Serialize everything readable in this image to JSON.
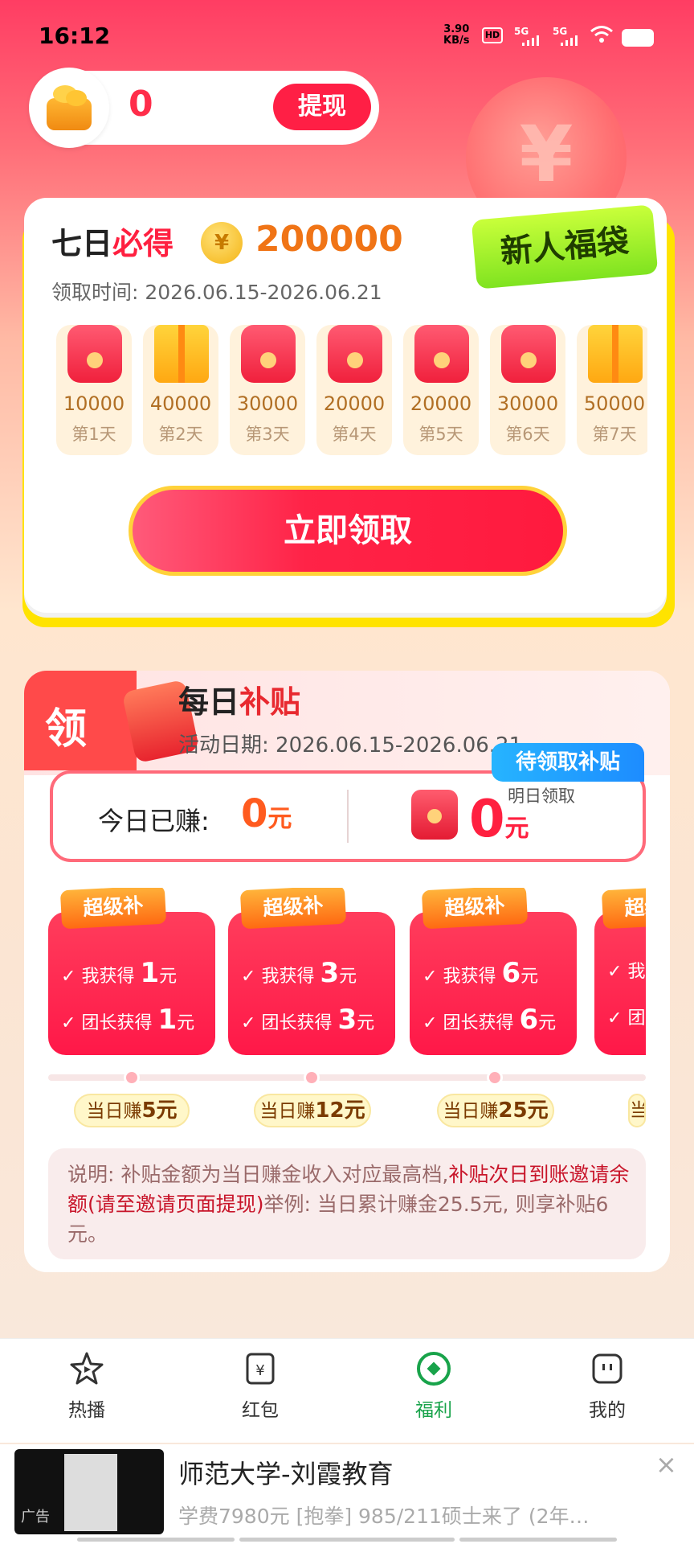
{
  "status": {
    "time": "16:12",
    "speed_top": "3.90",
    "speed_bottom": "KB/s",
    "hd": "HD",
    "net1": "5G",
    "net2": "5G"
  },
  "colors": {
    "accent": "#ff1f45",
    "orange": "#f07416",
    "green": "#18a34a",
    "lime": "#9cf02a"
  },
  "balance": {
    "value": "0",
    "withdraw_label": "提现"
  },
  "seven_day": {
    "title_plain": "七日",
    "title_highlight": "必得",
    "coin_symbol": "¥",
    "amount": "200000",
    "period": "领取时间: 2026.06.15-2026.06.21",
    "badge": "新人福袋",
    "days": [
      {
        "value": "10000",
        "label": "第1天",
        "icon": "red-envelope-icon"
      },
      {
        "value": "40000",
        "label": "第2天",
        "icon": "gift-box-icon"
      },
      {
        "value": "30000",
        "label": "第3天",
        "icon": "red-envelope-icon"
      },
      {
        "value": "20000",
        "label": "第4天",
        "icon": "red-envelope-icon"
      },
      {
        "value": "20000",
        "label": "第5天",
        "icon": "red-envelope-icon"
      },
      {
        "value": "30000",
        "label": "第6天",
        "icon": "red-envelope-icon"
      },
      {
        "value": "50000",
        "label": "第7天",
        "icon": "gift-box-icon"
      }
    ],
    "claim_label": "立即领取"
  },
  "subsidy": {
    "ling": "领",
    "title_plain": "每日",
    "title_highlight": "补贴",
    "period": "活动日期: 2026.06.15-2026.06.21",
    "pending_tag": "待领取补贴",
    "earned_label": "今日已赚:",
    "earned_value": "0",
    "unit": "元",
    "tomorrow_label": "明日领取",
    "tomorrow_value": "0",
    "tiers": [
      {
        "badge": "超级补",
        "me_label": "我获得",
        "me_value": "1",
        "leader_label": "团长获得",
        "leader_value": "1",
        "milestone_prefix": "当日赚",
        "milestone_value": "5元"
      },
      {
        "badge": "超级补",
        "me_label": "我获得",
        "me_value": "3",
        "leader_label": "团长获得",
        "leader_value": "3",
        "milestone_prefix": "当日赚",
        "milestone_value": "12元"
      },
      {
        "badge": "超级补",
        "me_label": "我获得",
        "me_value": "6",
        "leader_label": "团长获得",
        "leader_value": "6",
        "milestone_prefix": "当日赚",
        "milestone_value": "25元"
      },
      {
        "badge": "超级补",
        "me_label": "我",
        "me_value": "",
        "leader_label": "团",
        "leader_value": "",
        "milestone_prefix": "当",
        "milestone_value": ""
      }
    ],
    "note_intro": "说明: 补贴金额为当日赚金收入对应最高档,",
    "note_em": "补贴次日到账邀请余额(请至邀请页面提现)",
    "note_tail": "举例: 当日累计赚金25.5元, 则享补贴6元。"
  },
  "nav": [
    {
      "label": "热播",
      "icon": "play-star-icon"
    },
    {
      "label": "红包",
      "icon": "yuan-card-icon"
    },
    {
      "label": "福利",
      "icon": "welfare-circle-icon",
      "active": true
    },
    {
      "label": "我的",
      "icon": "profile-face-icon"
    }
  ],
  "ad": {
    "tag": "广告",
    "title": "师范大学-刘霞教育",
    "subtitle": "学费7980元 [抱拳] 985/211硕士来了 (2年…",
    "close": "×"
  }
}
